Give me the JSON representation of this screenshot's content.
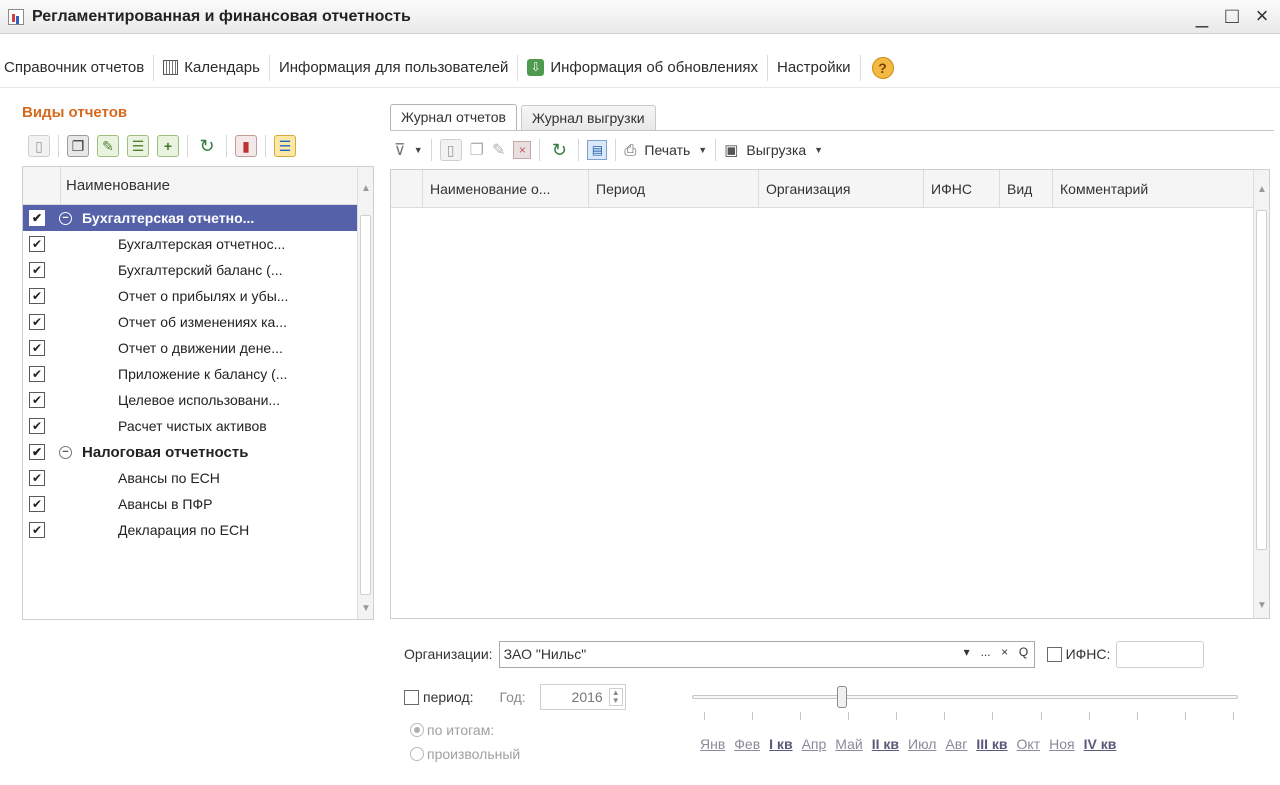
{
  "window": {
    "title": "Регламентированная и финансовая отчетность",
    "controls": {
      "minimize": "_",
      "maximize": "□",
      "close": "×"
    }
  },
  "menu": {
    "reference": "Справочник отчетов",
    "calendar": "Календарь",
    "user_info": "Информация для пользователей",
    "update_info": "Информация об обновлениях",
    "settings": "Настройки",
    "help_glyph": "?"
  },
  "left_panel": {
    "title": "Виды отчетов",
    "column_header": "Наименование",
    "rows": [
      {
        "label": "Бухгалтерская отчетно...",
        "checked": "✔",
        "collapse": "−"
      },
      {
        "label": "Бухгалтерская отчетнос...",
        "checked": "✔"
      },
      {
        "label": "Бухгалтерский баланс (...",
        "checked": "✔"
      },
      {
        "label": "Отчет о прибылях и убы...",
        "checked": "✔"
      },
      {
        "label": "Отчет об изменениях ка...",
        "checked": "✔"
      },
      {
        "label": "Отчет о движении дене...",
        "checked": "✔"
      },
      {
        "label": "Приложение к балансу (...",
        "checked": "✔"
      },
      {
        "label": "Целевое использовани...",
        "checked": "✔"
      },
      {
        "label": "Расчет чистых активов",
        "checked": "✔"
      },
      {
        "label": "Налоговая отчетность",
        "checked": "✔",
        "collapse": "−"
      },
      {
        "label": "Авансы по ЕСН",
        "checked": "✔"
      },
      {
        "label": "Авансы в ПФР",
        "checked": "✔"
      },
      {
        "label": "Декларация по ЕСН",
        "checked": "✔"
      }
    ]
  },
  "right_panel": {
    "tabs": [
      "Журнал отчетов",
      "Журнал выгрузки"
    ],
    "toolbar": {
      "print": "Печать",
      "export": "Выгрузка"
    },
    "columns": [
      "Наименование о...",
      "Период",
      "Организация",
      "ИФНС",
      "Вид",
      "Комментарий"
    ]
  },
  "filters": {
    "org_label": "Организации:",
    "org_value": "ЗАО \"Нильс\"",
    "org_buttons": {
      "dropdown": "▾",
      "select": "...",
      "clear": "×",
      "search": "Q"
    },
    "ifns_label": "ИФНС:",
    "period_label": "период:",
    "year_label": "Год:",
    "year_value": "2016",
    "year_slider_value": "2016",
    "radio_totals": "по итогам:",
    "radio_custom": "произвольный",
    "months": [
      "Янв",
      "Фев",
      "I кв",
      "Апр",
      "Май",
      "II кв",
      "Июл",
      "Авг",
      "III кв",
      "Окт",
      "Ноя",
      "IV кв"
    ]
  }
}
